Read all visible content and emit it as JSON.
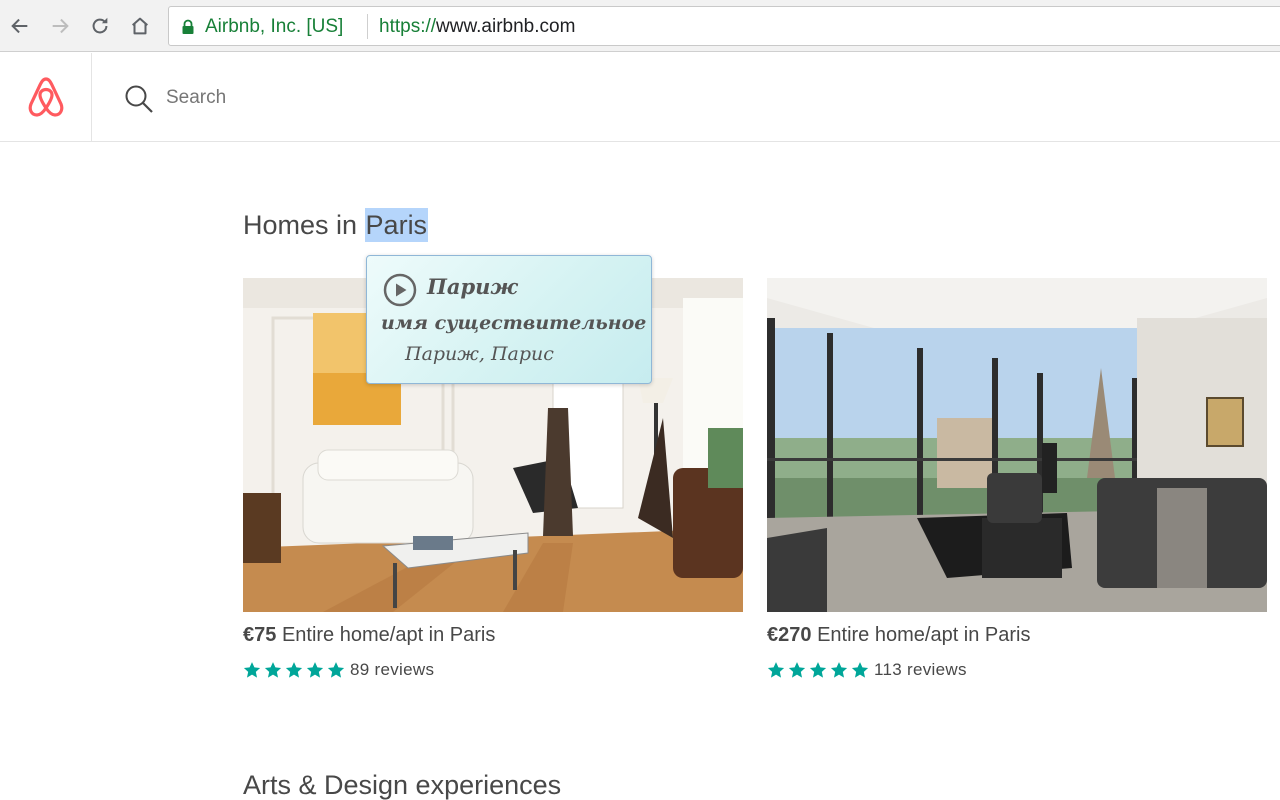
{
  "browser": {
    "ev_certificate": "Airbnb, Inc. [US]",
    "url_scheme": "https://",
    "url_host": "www.airbnb.com"
  },
  "header": {
    "search_placeholder": "Search"
  },
  "main": {
    "section_title_prefix": "Homes in ",
    "section_title_highlight": "Paris",
    "next_section_title": "Arts & Design experiences",
    "listings": [
      {
        "price": "€75",
        "description": "Entire home/apt in Paris",
        "rating": 5,
        "reviews": "89 reviews"
      },
      {
        "price": "€270",
        "description": "Entire home/apt in Paris",
        "rating": 5,
        "reviews": "113 reviews"
      }
    ]
  },
  "dictionary_popup": {
    "word": "Париж",
    "part_of_speech": "имя существительное",
    "translation": "Париж, Парис"
  },
  "colors": {
    "brand": "#ff5a5f",
    "star": "#00a699",
    "secure_green": "#188038",
    "selection": "#b5d5fb"
  },
  "icons": [
    "back-arrow-icon",
    "forward-arrow-icon",
    "reload-icon",
    "home-icon",
    "lock-icon",
    "airbnb-logo-icon",
    "search-icon",
    "star-icon",
    "play-icon"
  ]
}
